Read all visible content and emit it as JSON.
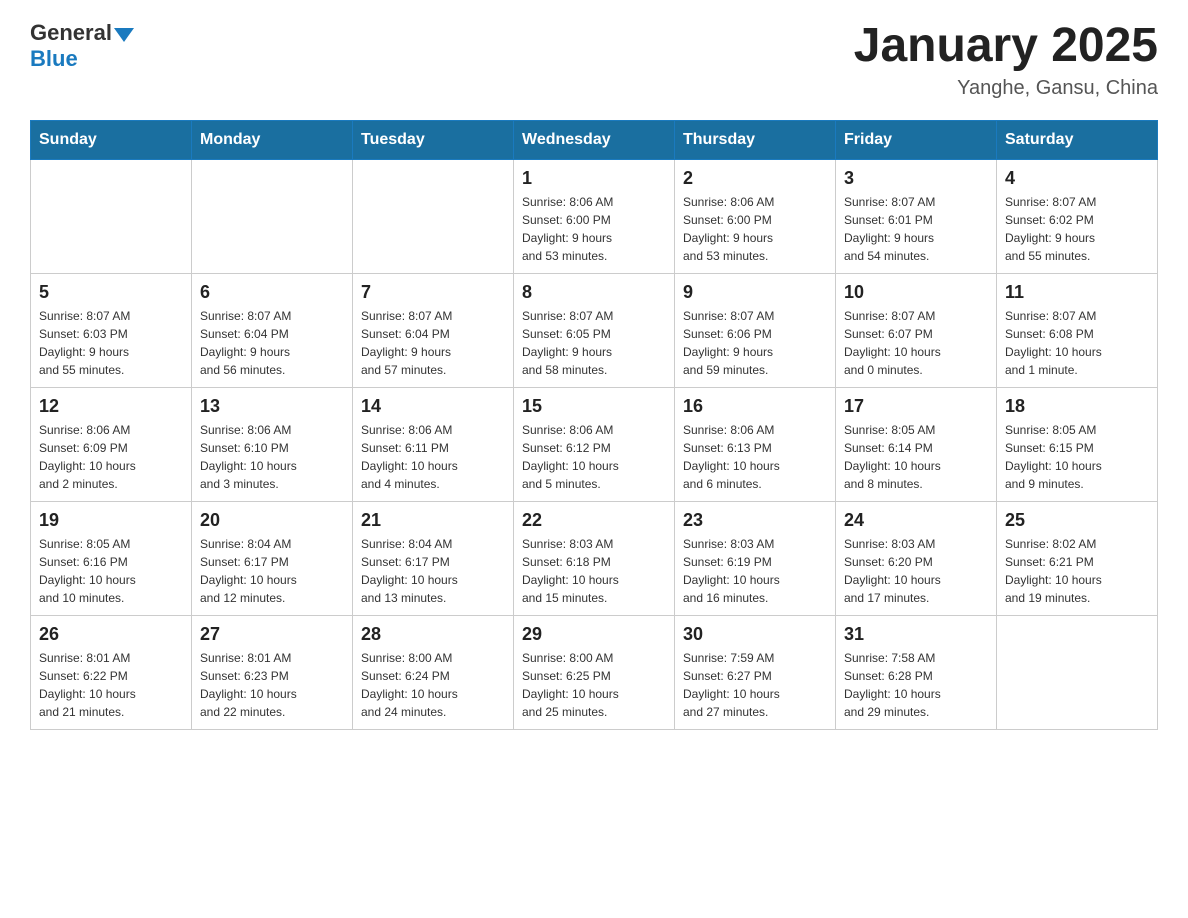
{
  "header": {
    "logo_general": "General",
    "logo_blue": "Blue",
    "month_title": "January 2025",
    "location": "Yanghe, Gansu, China"
  },
  "days_of_week": [
    "Sunday",
    "Monday",
    "Tuesday",
    "Wednesday",
    "Thursday",
    "Friday",
    "Saturday"
  ],
  "weeks": [
    [
      {
        "day": "",
        "info": ""
      },
      {
        "day": "",
        "info": ""
      },
      {
        "day": "",
        "info": ""
      },
      {
        "day": "1",
        "info": "Sunrise: 8:06 AM\nSunset: 6:00 PM\nDaylight: 9 hours\nand 53 minutes."
      },
      {
        "day": "2",
        "info": "Sunrise: 8:06 AM\nSunset: 6:00 PM\nDaylight: 9 hours\nand 53 minutes."
      },
      {
        "day": "3",
        "info": "Sunrise: 8:07 AM\nSunset: 6:01 PM\nDaylight: 9 hours\nand 54 minutes."
      },
      {
        "day": "4",
        "info": "Sunrise: 8:07 AM\nSunset: 6:02 PM\nDaylight: 9 hours\nand 55 minutes."
      }
    ],
    [
      {
        "day": "5",
        "info": "Sunrise: 8:07 AM\nSunset: 6:03 PM\nDaylight: 9 hours\nand 55 minutes."
      },
      {
        "day": "6",
        "info": "Sunrise: 8:07 AM\nSunset: 6:04 PM\nDaylight: 9 hours\nand 56 minutes."
      },
      {
        "day": "7",
        "info": "Sunrise: 8:07 AM\nSunset: 6:04 PM\nDaylight: 9 hours\nand 57 minutes."
      },
      {
        "day": "8",
        "info": "Sunrise: 8:07 AM\nSunset: 6:05 PM\nDaylight: 9 hours\nand 58 minutes."
      },
      {
        "day": "9",
        "info": "Sunrise: 8:07 AM\nSunset: 6:06 PM\nDaylight: 9 hours\nand 59 minutes."
      },
      {
        "day": "10",
        "info": "Sunrise: 8:07 AM\nSunset: 6:07 PM\nDaylight: 10 hours\nand 0 minutes."
      },
      {
        "day": "11",
        "info": "Sunrise: 8:07 AM\nSunset: 6:08 PM\nDaylight: 10 hours\nand 1 minute."
      }
    ],
    [
      {
        "day": "12",
        "info": "Sunrise: 8:06 AM\nSunset: 6:09 PM\nDaylight: 10 hours\nand 2 minutes."
      },
      {
        "day": "13",
        "info": "Sunrise: 8:06 AM\nSunset: 6:10 PM\nDaylight: 10 hours\nand 3 minutes."
      },
      {
        "day": "14",
        "info": "Sunrise: 8:06 AM\nSunset: 6:11 PM\nDaylight: 10 hours\nand 4 minutes."
      },
      {
        "day": "15",
        "info": "Sunrise: 8:06 AM\nSunset: 6:12 PM\nDaylight: 10 hours\nand 5 minutes."
      },
      {
        "day": "16",
        "info": "Sunrise: 8:06 AM\nSunset: 6:13 PM\nDaylight: 10 hours\nand 6 minutes."
      },
      {
        "day": "17",
        "info": "Sunrise: 8:05 AM\nSunset: 6:14 PM\nDaylight: 10 hours\nand 8 minutes."
      },
      {
        "day": "18",
        "info": "Sunrise: 8:05 AM\nSunset: 6:15 PM\nDaylight: 10 hours\nand 9 minutes."
      }
    ],
    [
      {
        "day": "19",
        "info": "Sunrise: 8:05 AM\nSunset: 6:16 PM\nDaylight: 10 hours\nand 10 minutes."
      },
      {
        "day": "20",
        "info": "Sunrise: 8:04 AM\nSunset: 6:17 PM\nDaylight: 10 hours\nand 12 minutes."
      },
      {
        "day": "21",
        "info": "Sunrise: 8:04 AM\nSunset: 6:17 PM\nDaylight: 10 hours\nand 13 minutes."
      },
      {
        "day": "22",
        "info": "Sunrise: 8:03 AM\nSunset: 6:18 PM\nDaylight: 10 hours\nand 15 minutes."
      },
      {
        "day": "23",
        "info": "Sunrise: 8:03 AM\nSunset: 6:19 PM\nDaylight: 10 hours\nand 16 minutes."
      },
      {
        "day": "24",
        "info": "Sunrise: 8:03 AM\nSunset: 6:20 PM\nDaylight: 10 hours\nand 17 minutes."
      },
      {
        "day": "25",
        "info": "Sunrise: 8:02 AM\nSunset: 6:21 PM\nDaylight: 10 hours\nand 19 minutes."
      }
    ],
    [
      {
        "day": "26",
        "info": "Sunrise: 8:01 AM\nSunset: 6:22 PM\nDaylight: 10 hours\nand 21 minutes."
      },
      {
        "day": "27",
        "info": "Sunrise: 8:01 AM\nSunset: 6:23 PM\nDaylight: 10 hours\nand 22 minutes."
      },
      {
        "day": "28",
        "info": "Sunrise: 8:00 AM\nSunset: 6:24 PM\nDaylight: 10 hours\nand 24 minutes."
      },
      {
        "day": "29",
        "info": "Sunrise: 8:00 AM\nSunset: 6:25 PM\nDaylight: 10 hours\nand 25 minutes."
      },
      {
        "day": "30",
        "info": "Sunrise: 7:59 AM\nSunset: 6:27 PM\nDaylight: 10 hours\nand 27 minutes."
      },
      {
        "day": "31",
        "info": "Sunrise: 7:58 AM\nSunset: 6:28 PM\nDaylight: 10 hours\nand 29 minutes."
      },
      {
        "day": "",
        "info": ""
      }
    ]
  ]
}
